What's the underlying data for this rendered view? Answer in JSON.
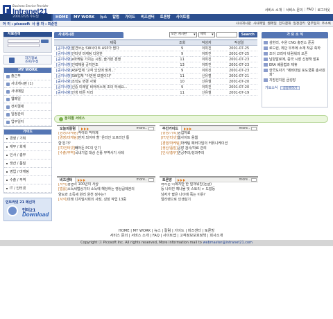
{
  "header": {
    "logo_sub": "Business Service Provider",
    "logo_name": "Intranet21",
    "top_links": [
      "서비스 소개",
      "서비스 문의",
      "FAQ",
      "로그아웃"
    ]
  },
  "gnb": {
    "date": "2001/7/25 수요일",
    "menu": [
      "HOME",
      "MY WORK",
      "뉴스",
      "칼럼",
      "가이드",
      "비즈센터",
      "토론방",
      "사이트맵"
    ],
    "active": "HOME"
  },
  "subbar": {
    "id_label": "아 이 : picosoft",
    "user_label": "사 용 자 : 최준진",
    "links": [
      "사내게시판",
      "사내메일",
      "웹메일",
      "전자결재",
      "일정관리",
      "업무일지",
      "주소록"
    ]
  },
  "left": {
    "login_head": "자료검색",
    "join_label_1": "자기정보",
    "join_label_2": "조회/수정",
    "mywork_head": "MY WORK",
    "mywork_items": [
      "출근부",
      "사내게시판 (1)",
      "사내메일",
      "웹메일",
      "전자결재",
      "일정관리",
      "업무일지"
    ],
    "guide_head": "가이드",
    "guide_items": [
      "경영 / 기획",
      "재무 / 회계",
      "인사 / 총무",
      "생산 / 품질",
      "영업 / 마케팅",
      "수출 / 무역",
      "IT / 인터넷"
    ],
    "messenger_title": "인트라넷 21 메신저",
    "messenger_name": "인터21",
    "messenger_dl": "Download"
  },
  "board": {
    "tab": "사내게시판",
    "filter_1": "모든 게시판",
    "filter_2": "제목",
    "search_btn": "Search",
    "columns": [
      "제목",
      "조회",
      "작성자",
      "작성일"
    ],
    "rows": [
      {
        "cat": "[공지사항]",
        "title": "발견쓰는 SW사이트 ASP가 뭔다",
        "views": "9",
        "author": "이미진",
        "date": "2001-07-25"
      },
      {
        "cat": "[공지사항]",
        "title": "인터넷 마케팅 다양한",
        "views": "9",
        "author": "이미진",
        "date": "2001-07-25"
      },
      {
        "cat": "[공지사항]",
        "title": "e마케팅 가치는 시장, 솔가본 경쟁",
        "views": "11",
        "author": "이미진",
        "date": "2001-07-23"
      },
      {
        "cat": "[공지사항]",
        "title": "인력채용 공지안조",
        "views": "13",
        "author": "이미진",
        "date": "2001-07-23"
      },
      {
        "cat": "[공지사항]",
        "title": "ASP업체 '고객 있었에 맞게...'",
        "views": "9",
        "author": "이미진",
        "date": "2001-07-23"
      },
      {
        "cat": "[공지사항]",
        "title": "SW업체 \"이번엔 모델이다\"",
        "views": "11",
        "author": "신유철",
        "date": "2001-07-21"
      },
      {
        "cat": "[공지사항]",
        "title": "조직도 변경 사항",
        "views": "10",
        "author": "신유철",
        "date": "2001-07-20"
      },
      {
        "cat": "[공지사항]",
        "title": "신중 미래알 비어러스에 조의 하세요...",
        "views": "9",
        "author": "이미진",
        "date": "2001-07-20"
      },
      {
        "cat": "[공지사항]",
        "title": "인생 버튼 지리",
        "views": "11",
        "author": "신유철",
        "date": "2001-07-19"
      }
    ]
  },
  "rightcol": {
    "head": "가 요 소 식",
    "items": [
      "삼현리, 수원 CNG 충전소 준공",
      "로드런, 최단 우주에 소재 착공 축하",
      "조이 코리아 바람워의 오픈",
      "남양알로에, 중국 시장 신정책 발표",
      "ERA 베를법과 제휴",
      "한국도자기 \"제비대덜 포도궁풍 총사원회\"",
      "지방선지원 금성장"
    ],
    "more_label": "가요소식",
    "more_btn": "공동룩하기"
  },
  "partner": {
    "label": "분야별 서비스"
  },
  "sections": {
    "s1": {
      "title": "오늘의칼럼",
      "more": "more..",
      "rows": [
        {
          "cat": "[경영/마케팅]",
          "text": "막아와 막어제"
        },
        {
          "cat": "[경영/마케팅]",
          "text": "만지 되어야 할 '온라인 오프라인 통"
        },
        {
          "cat": "",
          "text": "합'은가?"
        },
        {
          "cat": "[IT/인터넷]",
          "text": "빼어든 PC의 인기"
        },
        {
          "cat": "[수출/무역]",
          "text": "국내기업 대상 신종 무역사기 사례"
        }
      ]
    },
    "s2": {
      "title": "주간가이드",
      "more": "more..",
      "rows": [
        {
          "cat": "[경영/기획]",
          "text": "영업자료"
        },
        {
          "cat": "[IT/인터넷]",
          "text": "웹사이트 용웹"
        },
        {
          "cat": "[경영/마케팅]",
          "text": "마케팅 패러다임의 커뮤니케이션"
        },
        {
          "cat": "[생산/품질]",
          "text": "공장 검사/자료 관리"
        },
        {
          "cat": "[인사/총무]",
          "text": "연공주의/성과주의"
        }
      ]
    },
    "s3": {
      "title": "비즈센터",
      "more": "more..",
      "rows": [
        {
          "cat": "[서식]",
          "text": "경영의 100년의 사상"
        },
        {
          "cat": "[법률]",
          "text": "소득세법상기타 소득에 해당하는 영상급제권의"
        },
        {
          "cat": "",
          "text": "양도와 소득세 원리 원천 징수는?"
        },
        {
          "cat": "[서식]",
          "text": "미래 디지털사회의 사장, 성장 작업 13중"
        }
      ]
    },
    "s4": {
      "title": "토론방",
      "more": "more..",
      "rows": [
        {
          "cat": "",
          "text": "머리는 이제지만 한 얼개워진(돈글)"
        },
        {
          "cat": "",
          "text": "등 나라진 예나물 및 스토리 > 도밥등"
        },
        {
          "cat": "",
          "text": "남자가 짧은 나이에 죽는 이유?"
        },
        {
          "cat": "",
          "text": "얼리렛으로 인생살기"
        }
      ]
    }
  },
  "footer": {
    "line1": [
      "HOME",
      "MY WORK",
      "뉴스",
      "칼럼",
      "가이드",
      "비즈센터",
      "토론방"
    ],
    "line2": [
      "서비스 문의",
      "서비스 소개",
      "FAQ",
      "사이트맵",
      "고객정보보호정책",
      "회사소개"
    ],
    "copyright": "Copyright ⓒ Picosoft Inc. All rights reserved, More information mail to",
    "email": "webmaster@intranet21.com"
  },
  "colors": {
    "navy": "#2c4f8f",
    "accent": "#5576b4",
    "orange": "#e07a1c",
    "green": "#7ab04a"
  }
}
